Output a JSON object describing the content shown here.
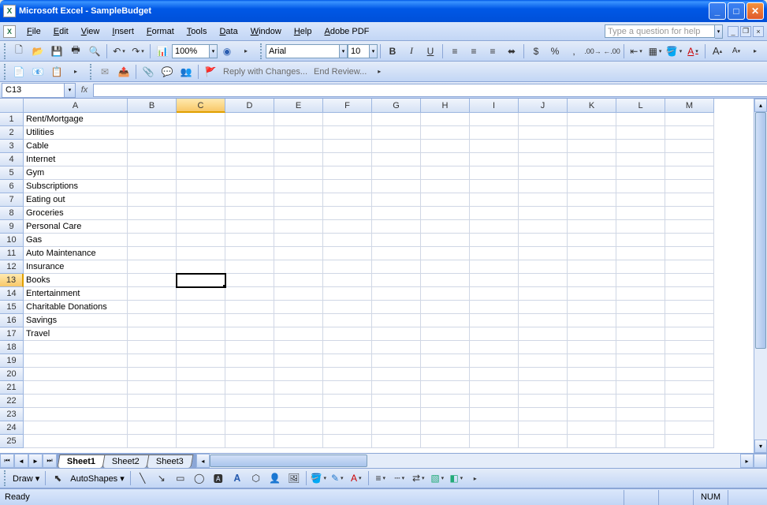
{
  "title": "Microsoft Excel - SampleBudget",
  "menu": [
    "File",
    "Edit",
    "View",
    "Insert",
    "Format",
    "Tools",
    "Data",
    "Window",
    "Help",
    "Adobe PDF"
  ],
  "help_placeholder": "Type a question for help",
  "zoom": "100%",
  "font_name": "Arial",
  "font_size": "10",
  "review": {
    "reply": "Reply with Changes...",
    "end": "End Review..."
  },
  "namebox": "C13",
  "formula": "",
  "columns": [
    "A",
    "B",
    "C",
    "D",
    "E",
    "F",
    "G",
    "H",
    "I",
    "J",
    "K",
    "L",
    "M"
  ],
  "col_widths": {
    "A": 132,
    "default": 62
  },
  "row_count": 25,
  "selected_cell": {
    "row": 13,
    "col": "C"
  },
  "data_A": [
    "Rent/Mortgage",
    "Utilities",
    "Cable",
    "Internet",
    "Gym",
    "Subscriptions",
    "Eating out",
    "Groceries",
    "Personal Care",
    "Gas",
    "Auto Maintenance",
    "Insurance",
    "Books",
    "Entertainment",
    "Charitable Donations",
    "Savings",
    "Travel"
  ],
  "sheet_tabs": [
    "Sheet1",
    "Sheet2",
    "Sheet3"
  ],
  "active_tab": 0,
  "draw_label": "Draw",
  "autoshapes_label": "AutoShapes",
  "status_text": "Ready",
  "status_numlock": "NUM"
}
